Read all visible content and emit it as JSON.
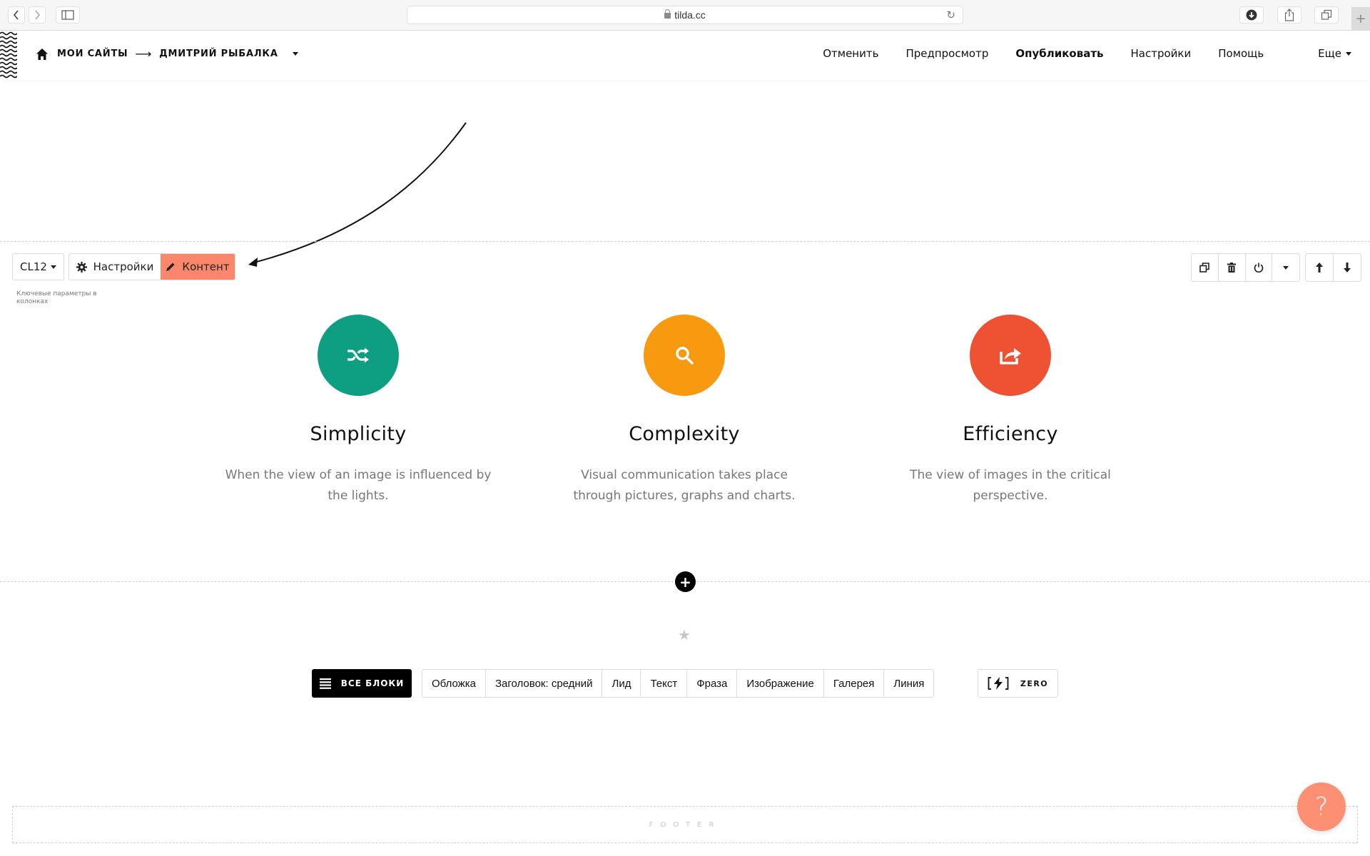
{
  "browser": {
    "url": "tilda.cc",
    "icons": [
      "back-icon",
      "forward-icon",
      "sidebar-icon",
      "lock-icon",
      "reload-icon",
      "download-icon",
      "share-icon",
      "tabs-icon",
      "new-tab-icon"
    ],
    "new_tab_label": "+"
  },
  "header": {
    "breadcrumb": {
      "home_icon": "home-icon",
      "root": "МОИ САЙТЫ",
      "separator": "⟶",
      "project": "ДМИТРИЙ РЫБАЛКА"
    },
    "menu": [
      {
        "label": "Отменить"
      },
      {
        "label": "Предпросмотр"
      },
      {
        "label": "Опубликовать"
      },
      {
        "label": "Настройки"
      },
      {
        "label": "Помощь"
      },
      {
        "label": "Еще"
      }
    ]
  },
  "block_toolbar": {
    "block_code": "CL12",
    "settings_label": "Настройки",
    "content_label": "Контент",
    "hint": "Ключевые параметры в колонках",
    "actions": [
      "duplicate-icon",
      "delete-icon",
      "power-icon",
      "more-caret-icon",
      "move-up-icon",
      "move-down-icon"
    ]
  },
  "features": [
    {
      "title": "Simplicity",
      "description": "When the view of an image is influenced by the lights.",
      "icon": "shuffle-icon",
      "color": "#0e9f82"
    },
    {
      "title": "Complexity",
      "description": "Visual communication takes place through pictures, graphs and charts.",
      "icon": "search-icon",
      "color": "#f89a0f"
    },
    {
      "title": "Efficiency",
      "description": "The view of images in the critical perspective.",
      "icon": "share-icon",
      "color": "#ee5232"
    }
  ],
  "add_block": {
    "plus_label": "+",
    "star_label": "★",
    "all_blocks_label": "ВСЕ БЛОКИ",
    "quick_blocks": [
      "Обложка",
      "Заголовок: средний",
      "Лид",
      "Текст",
      "Фраза",
      "Изображение",
      "Галерея",
      "Линия"
    ],
    "zero_label": "ZERO"
  },
  "footer": {
    "label": "FOOTER",
    "help_label": "?"
  },
  "colors": {
    "accent": "#fa876b",
    "help": "#fd8f72"
  }
}
